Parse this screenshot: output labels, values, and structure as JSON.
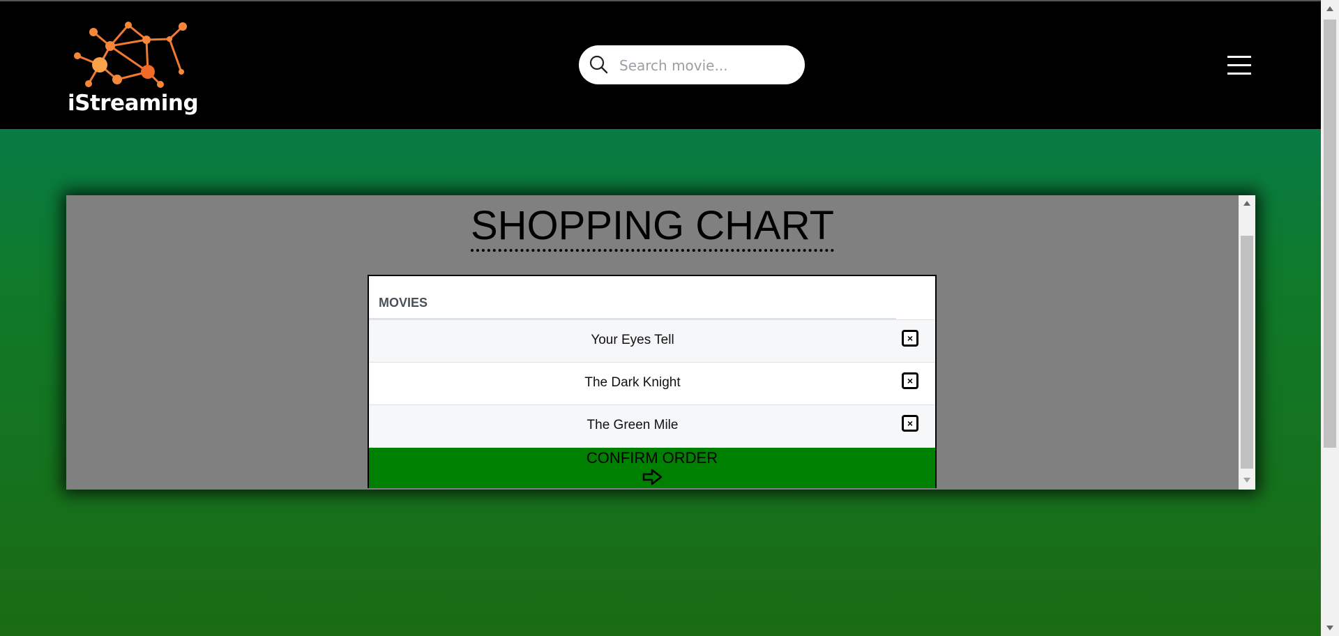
{
  "header": {
    "brand": "iStreaming",
    "search_placeholder": "Search movie...",
    "menu_icon": "hamburger-menu-icon"
  },
  "panel": {
    "title": "SHOPPING CHART",
    "cart": {
      "column_header": "MOVIES",
      "items": [
        {
          "title": "Your Eyes Tell",
          "remove_icon": "close-box-icon"
        },
        {
          "title": "The Dark Knight",
          "remove_icon": "close-box-icon"
        },
        {
          "title": "The Green Mile",
          "remove_icon": "close-box-icon"
        }
      ],
      "confirm_label": "CONFIRM ORDER",
      "confirm_icon": "arrow-right-icon"
    }
  },
  "colors": {
    "header_bg": "#000000",
    "logo_accent": "#f7883a",
    "panel_bg": "#808080",
    "confirm_bg": "#008000",
    "page_gradient_top": "#087b45",
    "page_gradient_bottom": "#1b6b13"
  }
}
